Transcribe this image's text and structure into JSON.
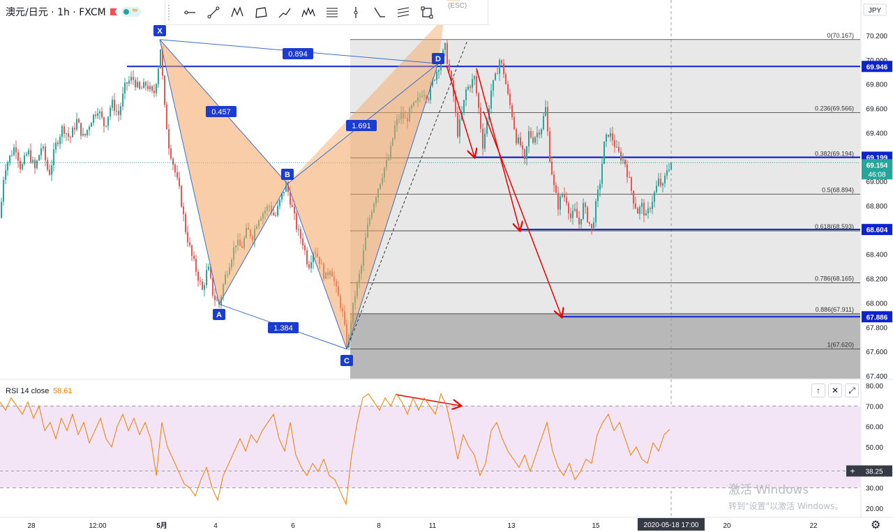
{
  "header": {
    "symbol": "澳元/日元 · 1h · FXCM"
  },
  "currency_badge": "JPY",
  "toolbar": {
    "esc_hint": "(ESC)"
  },
  "price_axis": {
    "ticks": [
      "70.200",
      "70.000",
      "69.800",
      "69.600",
      "69.400",
      "69.200",
      "69.000",
      "68.800",
      "68.600",
      "68.400",
      "68.200",
      "68.000",
      "67.800",
      "67.600",
      "67.400"
    ]
  },
  "price_labels": {
    "last_price": "69.154",
    "countdown": "46:08",
    "levels": [
      {
        "text": "69.946"
      },
      {
        "text": "69.199"
      },
      {
        "text": "68.604"
      },
      {
        "text": "67.886"
      }
    ]
  },
  "time_axis": {
    "ticks": [
      "28",
      "12:00",
      "5月",
      "4",
      "6",
      "8",
      "11",
      "13",
      "15",
      "20",
      "22"
    ],
    "cursor_label": "2020-05-18  17:00"
  },
  "fib": {
    "levels": [
      "0(70.167)",
      "0.236(69.566)",
      "0.382(69.194)",
      "0.5(68.894)",
      "0.618(68.593)",
      "0.786(68.165)",
      "0.886(67.911)",
      "1(67.620)"
    ],
    "level_values": [
      70.167,
      69.566,
      69.194,
      68.894,
      68.593,
      68.165,
      67.911,
      67.62
    ]
  },
  "pattern": {
    "points": [
      "X",
      "A",
      "B",
      "C",
      "D"
    ],
    "ratios": [
      "0.894",
      "0.457",
      "1.691",
      "1.384"
    ]
  },
  "rsi": {
    "title": "RSI 14 close",
    "value": "58.61",
    "cursor_value": "38.25",
    "ticks": [
      "80.00",
      "70.00",
      "60.00",
      "50.00",
      "40.00",
      "30.00",
      "20.00"
    ]
  },
  "watermark": {
    "line1": "激活 Windows",
    "line2": "转到\"设置\"以激活 Windows。"
  },
  "colors": {
    "up": "#26a69a",
    "down": "#ef5350",
    "blue": "#0d23cf",
    "label_blue": "#1c3bd0",
    "pattern_fill": "#f4a460",
    "rsi": "#f57c00",
    "rsi_band": "#f3e5f5"
  },
  "chart_data": {
    "type": "candlestick",
    "symbol": "澳元/日元",
    "interval": "1h",
    "ylim": [
      67.4,
      70.22
    ],
    "harmonic_pattern": {
      "X": 70.167,
      "A": 67.99,
      "B": 68.98,
      "C": 67.62,
      "D": 69.97,
      "XD_ratio": 0.894,
      "XB_ratio": 0.457,
      "BD_ratio": 1.691,
      "AC_ratio": 1.384
    },
    "horizontal_levels": [
      69.946,
      69.199,
      68.604,
      67.886
    ],
    "fib_retracement": [
      {
        "ratio": 0,
        "price": 70.167
      },
      {
        "ratio": 0.236,
        "price": 69.566
      },
      {
        "ratio": 0.382,
        "price": 69.194
      },
      {
        "ratio": 0.5,
        "price": 68.894
      },
      {
        "ratio": 0.618,
        "price": 68.593
      },
      {
        "ratio": 0.786,
        "price": 68.165
      },
      {
        "ratio": 0.886,
        "price": 67.911
      },
      {
        "ratio": 1,
        "price": 67.62
      }
    ],
    "close_path": [
      [
        0,
        68.7
      ],
      [
        6,
        69.1
      ],
      [
        14,
        69.2
      ],
      [
        22,
        69.3
      ],
      [
        30,
        69.1
      ],
      [
        40,
        69.25
      ],
      [
        50,
        69.1
      ],
      [
        60,
        69.3
      ],
      [
        70,
        69.05
      ],
      [
        80,
        69.3
      ],
      [
        90,
        69.45
      ],
      [
        100,
        69.35
      ],
      [
        110,
        69.5
      ],
      [
        120,
        69.35
      ],
      [
        130,
        69.5
      ],
      [
        140,
        69.6
      ],
      [
        150,
        69.45
      ],
      [
        160,
        69.65
      ],
      [
        170,
        69.55
      ],
      [
        180,
        69.8
      ],
      [
        190,
        69.85
      ],
      [
        200,
        69.75
      ],
      [
        210,
        69.8
      ],
      [
        220,
        69.7
      ],
      [
        226,
        69.9
      ],
      [
        230,
        70.1
      ],
      [
        236,
        69.6
      ],
      [
        242,
        69.3
      ],
      [
        250,
        69.1
      ],
      [
        258,
        68.9
      ],
      [
        266,
        68.6
      ],
      [
        274,
        68.4
      ],
      [
        282,
        68.25
      ],
      [
        290,
        68.1
      ],
      [
        298,
        68.3
      ],
      [
        306,
        68.05
      ],
      [
        314,
        67.99
      ],
      [
        322,
        68.2
      ],
      [
        330,
        68.35
      ],
      [
        338,
        68.5
      ],
      [
        346,
        68.45
      ],
      [
        354,
        68.6
      ],
      [
        362,
        68.55
      ],
      [
        370,
        68.7
      ],
      [
        378,
        68.75
      ],
      [
        386,
        68.8
      ],
      [
        394,
        68.7
      ],
      [
        402,
        68.85
      ],
      [
        410,
        68.98
      ],
      [
        418,
        68.8
      ],
      [
        426,
        68.6
      ],
      [
        434,
        68.5
      ],
      [
        442,
        68.3
      ],
      [
        450,
        68.45
      ],
      [
        458,
        68.35
      ],
      [
        466,
        68.2
      ],
      [
        474,
        68.3
      ],
      [
        482,
        68.1
      ],
      [
        490,
        67.95
      ],
      [
        498,
        67.62
      ],
      [
        504,
        67.9
      ],
      [
        510,
        68.1
      ],
      [
        518,
        68.3
      ],
      [
        526,
        68.6
      ],
      [
        534,
        68.8
      ],
      [
        542,
        68.95
      ],
      [
        550,
        69.1
      ],
      [
        558,
        69.2
      ],
      [
        566,
        69.45
      ],
      [
        574,
        69.55
      ],
      [
        582,
        69.5
      ],
      [
        590,
        69.6
      ],
      [
        598,
        69.65
      ],
      [
        606,
        69.75
      ],
      [
        614,
        69.7
      ],
      [
        622,
        69.85
      ],
      [
        630,
        69.97
      ],
      [
        638,
        70.1
      ],
      [
        644,
        69.9
      ],
      [
        650,
        69.7
      ],
      [
        656,
        69.4
      ],
      [
        662,
        69.55
      ],
      [
        668,
        69.75
      ],
      [
        674,
        69.8
      ],
      [
        680,
        69.85
      ],
      [
        686,
        69.6
      ],
      [
        692,
        69.3
      ],
      [
        698,
        69.5
      ],
      [
        704,
        69.75
      ],
      [
        710,
        69.85
      ],
      [
        716,
        70.0
      ],
      [
        722,
        69.9
      ],
      [
        728,
        69.7
      ],
      [
        734,
        69.55
      ],
      [
        740,
        69.35
      ],
      [
        746,
        69.3
      ],
      [
        752,
        69.15
      ],
      [
        758,
        69.4
      ],
      [
        764,
        69.35
      ],
      [
        770,
        69.4
      ],
      [
        776,
        69.45
      ],
      [
        782,
        69.6
      ],
      [
        788,
        69.2
      ],
      [
        794,
        68.95
      ],
      [
        800,
        68.8
      ],
      [
        806,
        68.9
      ],
      [
        812,
        68.85
      ],
      [
        818,
        68.7
      ],
      [
        824,
        68.75
      ],
      [
        830,
        68.65
      ],
      [
        836,
        68.8
      ],
      [
        842,
        68.7
      ],
      [
        848,
        68.6
      ],
      [
        854,
        68.8
      ],
      [
        860,
        69.0
      ],
      [
        866,
        69.3
      ],
      [
        872,
        69.4
      ],
      [
        878,
        69.35
      ],
      [
        884,
        69.25
      ],
      [
        890,
        69.2
      ],
      [
        896,
        69.15
      ],
      [
        902,
        69.0
      ],
      [
        908,
        68.85
      ],
      [
        914,
        68.75
      ],
      [
        920,
        68.8
      ],
      [
        926,
        68.7
      ],
      [
        932,
        68.8
      ],
      [
        938,
        68.9
      ],
      [
        944,
        69.0
      ],
      [
        950,
        68.95
      ],
      [
        956,
        69.1
      ],
      [
        962,
        69.154
      ]
    ],
    "rsi_series": [
      [
        0,
        72
      ],
      [
        8,
        68
      ],
      [
        16,
        74
      ],
      [
        24,
        70
      ],
      [
        32,
        66
      ],
      [
        40,
        72
      ],
      [
        48,
        64
      ],
      [
        56,
        70
      ],
      [
        64,
        58
      ],
      [
        72,
        62
      ],
      [
        80,
        54
      ],
      [
        88,
        64
      ],
      [
        96,
        58
      ],
      [
        104,
        66
      ],
      [
        112,
        56
      ],
      [
        120,
        62
      ],
      [
        128,
        52
      ],
      [
        136,
        58
      ],
      [
        144,
        64
      ],
      [
        152,
        54
      ],
      [
        160,
        50
      ],
      [
        168,
        60
      ],
      [
        176,
        66
      ],
      [
        184,
        58
      ],
      [
        192,
        64
      ],
      [
        200,
        56
      ],
      [
        208,
        62
      ],
      [
        216,
        54
      ],
      [
        224,
        36
      ],
      [
        232,
        62
      ],
      [
        240,
        50
      ],
      [
        248,
        44
      ],
      [
        256,
        38
      ],
      [
        264,
        32
      ],
      [
        272,
        30
      ],
      [
        280,
        26
      ],
      [
        288,
        34
      ],
      [
        296,
        40
      ],
      [
        304,
        30
      ],
      [
        312,
        24
      ],
      [
        320,
        36
      ],
      [
        328,
        42
      ],
      [
        336,
        48
      ],
      [
        344,
        54
      ],
      [
        352,
        48
      ],
      [
        360,
        56
      ],
      [
        368,
        52
      ],
      [
        376,
        58
      ],
      [
        384,
        62
      ],
      [
        392,
        66
      ],
      [
        400,
        54
      ],
      [
        408,
        48
      ],
      [
        416,
        62
      ],
      [
        424,
        46
      ],
      [
        432,
        40
      ],
      [
        440,
        36
      ],
      [
        448,
        42
      ],
      [
        456,
        38
      ],
      [
        464,
        44
      ],
      [
        472,
        36
      ],
      [
        480,
        34
      ],
      [
        488,
        28
      ],
      [
        496,
        22
      ],
      [
        504,
        46
      ],
      [
        512,
        62
      ],
      [
        520,
        74
      ],
      [
        528,
        76
      ],
      [
        536,
        72
      ],
      [
        544,
        68
      ],
      [
        552,
        74
      ],
      [
        560,
        70
      ],
      [
        568,
        76
      ],
      [
        576,
        72
      ],
      [
        584,
        66
      ],
      [
        592,
        74
      ],
      [
        600,
        68
      ],
      [
        608,
        74
      ],
      [
        616,
        70
      ],
      [
        624,
        66
      ],
      [
        632,
        76
      ],
      [
        640,
        70
      ],
      [
        648,
        58
      ],
      [
        656,
        44
      ],
      [
        664,
        56
      ],
      [
        672,
        50
      ],
      [
        680,
        46
      ],
      [
        688,
        36
      ],
      [
        696,
        42
      ],
      [
        704,
        58
      ],
      [
        712,
        62
      ],
      [
        720,
        54
      ],
      [
        728,
        48
      ],
      [
        736,
        44
      ],
      [
        744,
        40
      ],
      [
        752,
        46
      ],
      [
        760,
        38
      ],
      [
        768,
        46
      ],
      [
        776,
        54
      ],
      [
        784,
        62
      ],
      [
        792,
        48
      ],
      [
        800,
        40
      ],
      [
        808,
        36
      ],
      [
        816,
        42
      ],
      [
        824,
        34
      ],
      [
        832,
        38
      ],
      [
        840,
        44
      ],
      [
        848,
        42
      ],
      [
        856,
        56
      ],
      [
        864,
        62
      ],
      [
        872,
        66
      ],
      [
        880,
        58
      ],
      [
        888,
        62
      ],
      [
        896,
        54
      ],
      [
        904,
        46
      ],
      [
        912,
        50
      ],
      [
        920,
        44
      ],
      [
        928,
        42
      ],
      [
        936,
        52
      ],
      [
        944,
        48
      ],
      [
        952,
        56
      ],
      [
        960,
        58.61
      ]
    ]
  }
}
